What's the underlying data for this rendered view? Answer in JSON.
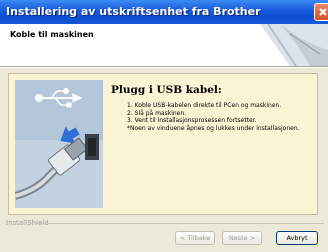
{
  "window": {
    "title": "Installering av utskriftsenhet fra Brother"
  },
  "header": {
    "title": "Koble til maskinen"
  },
  "panel": {
    "heading": "Plugg i USB kabel:",
    "steps": [
      "1. Koble USB-kabelen direkte til PCen og maskinen.",
      "2. Slå på maskinen.",
      "3. Vent til installasjonsprosessen fortsetter.",
      "*Noen av vinduene åpnes og lukkes under installasjonen."
    ]
  },
  "footer": {
    "group_label": "InstallShield"
  },
  "buttons": {
    "back": "< Tilbake",
    "next": "Neste >",
    "cancel": "Avbryt"
  },
  "colors": {
    "titlebar": "#0b4ed0",
    "panel_bg": "#faf4d5",
    "window_bg": "#ece9d8"
  },
  "icons": [
    "close-icon",
    "usb-icon",
    "arrow-icon",
    "usb-cable-icon"
  ]
}
